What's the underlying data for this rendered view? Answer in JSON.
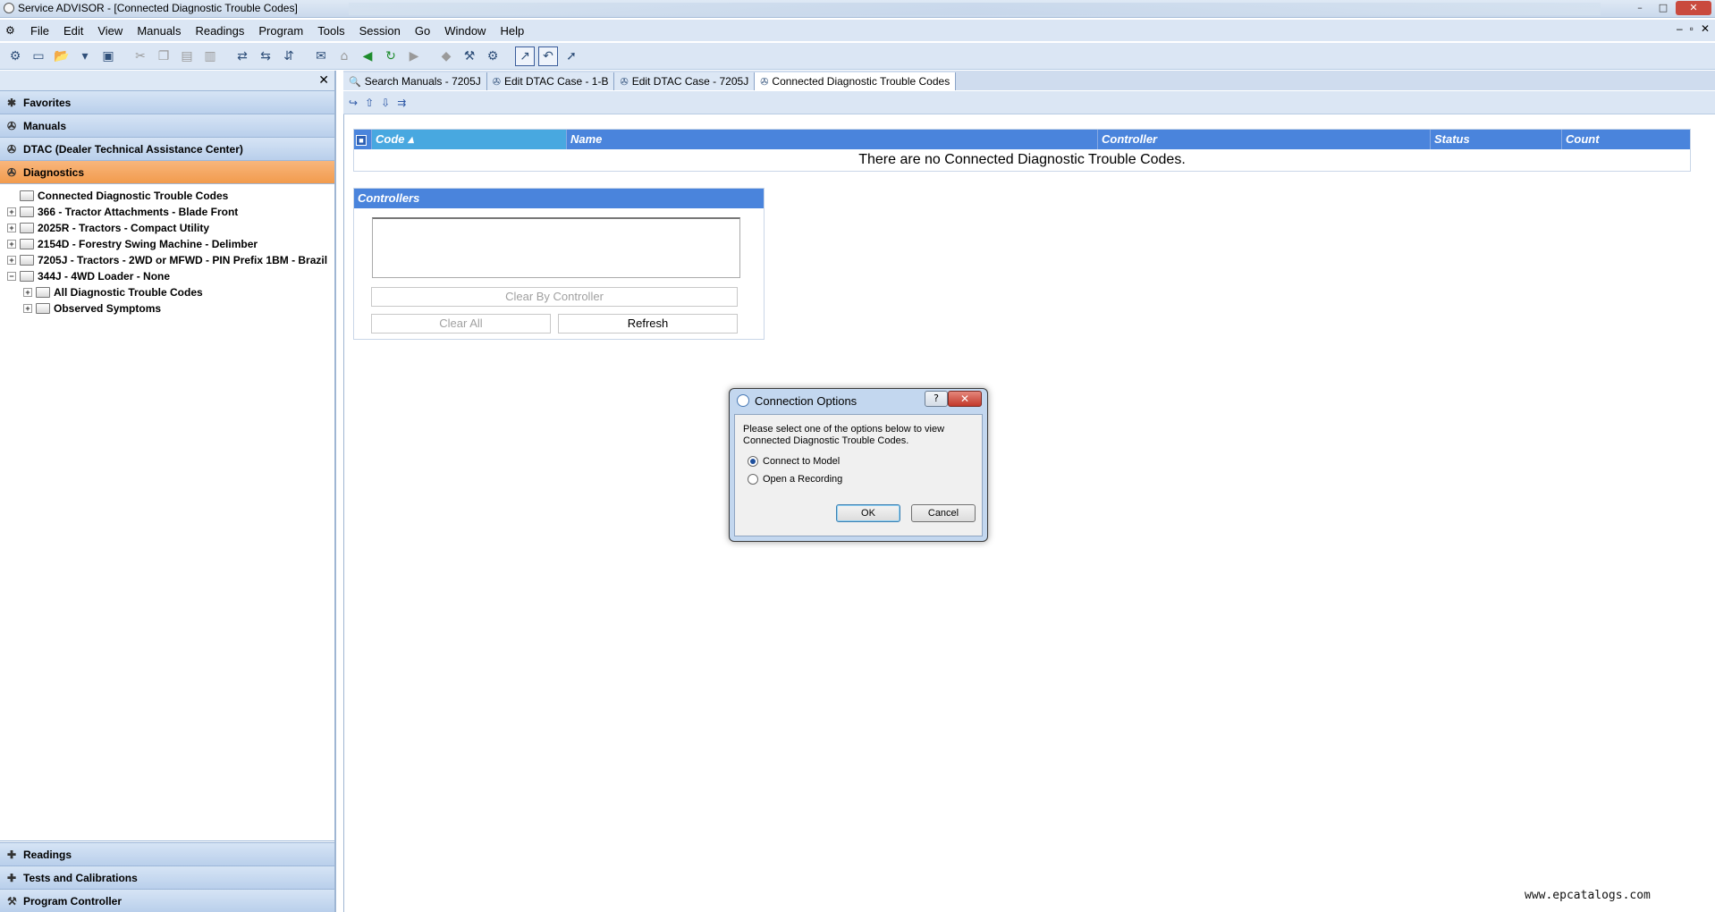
{
  "window": {
    "title": "Service ADVISOR - [Connected Diagnostic Trouble Codes]",
    "controls": [
      "–",
      "□",
      "✕"
    ],
    "mdi_controls": [
      "–",
      "▫",
      "✕"
    ]
  },
  "menubar": {
    "items": [
      "File",
      "Edit",
      "View",
      "Manuals",
      "Readings",
      "Program",
      "Tools",
      "Session",
      "Go",
      "Window",
      "Help"
    ]
  },
  "left_panel": {
    "close_label": "✕",
    "nav_top": [
      {
        "label": "Favorites",
        "icon": "gear-icon"
      },
      {
        "label": "Manuals",
        "icon": "manual-icon"
      },
      {
        "label": "DTAC (Dealer Technical Assistance Center)",
        "icon": "dtac-icon"
      },
      {
        "label": "Diagnostics",
        "icon": "diagnostics-icon"
      }
    ],
    "tree": [
      {
        "label": "Connected Diagnostic Trouble Codes",
        "indent": 1,
        "expander": ""
      },
      {
        "label": "366 - Tractor Attachments - Blade Front",
        "indent": 0,
        "expander": "+"
      },
      {
        "label": "2025R - Tractors - Compact Utility",
        "indent": 0,
        "expander": "+"
      },
      {
        "label": "2154D - Forestry Swing Machine - Delimber",
        "indent": 0,
        "expander": "+"
      },
      {
        "label": "7205J - Tractors - 2WD or MFWD - PIN Prefix 1BM - Brazil",
        "indent": 0,
        "expander": "+"
      },
      {
        "label": "344J - 4WD Loader - None",
        "indent": 0,
        "expander": "−"
      },
      {
        "label": "All Diagnostic Trouble Codes",
        "indent": 2,
        "expander": "+"
      },
      {
        "label": "Observed Symptoms",
        "indent": 2,
        "expander": "+"
      }
    ],
    "nav_bottom": [
      {
        "label": "Readings",
        "icon": "readings-icon"
      },
      {
        "label": "Tests and Calibrations",
        "icon": "tests-icon"
      },
      {
        "label": "Program Controller",
        "icon": "program-icon"
      }
    ]
  },
  "tabs": [
    {
      "label": "Search Manuals - 7205J",
      "icon": "search-icon"
    },
    {
      "label": "Edit DTAC Case - 1-B",
      "icon": "dtac-icon"
    },
    {
      "label": "Edit DTAC Case - 7205J",
      "icon": "dtac-icon"
    },
    {
      "label": "Connected Diagnostic Trouble Codes",
      "icon": "diagnostics-icon"
    }
  ],
  "dtc_table": {
    "columns": [
      "Code ▴",
      "Name",
      "Controller",
      "Status",
      "Count"
    ],
    "empty_message": "There are no Connected Diagnostic Trouble Codes."
  },
  "controllers": {
    "title": "Controllers",
    "clear_by_controller": "Clear By Controller",
    "clear_all": "Clear All",
    "refresh": "Refresh"
  },
  "dialog": {
    "title": "Connection Options",
    "help": "?",
    "close": "✕",
    "message": "Please select one of the options below to view Connected Diagnostic Trouble Codes.",
    "options": [
      "Connect to Model",
      "Open a Recording"
    ],
    "selected": "Connect to Model",
    "ok": "OK",
    "cancel": "Cancel"
  },
  "watermark": "www.epcatalogs.com",
  "colors": {
    "accent": "#4a84dc",
    "active_nav": "#f29b4d",
    "panel_bg": "#dbe6f4"
  }
}
